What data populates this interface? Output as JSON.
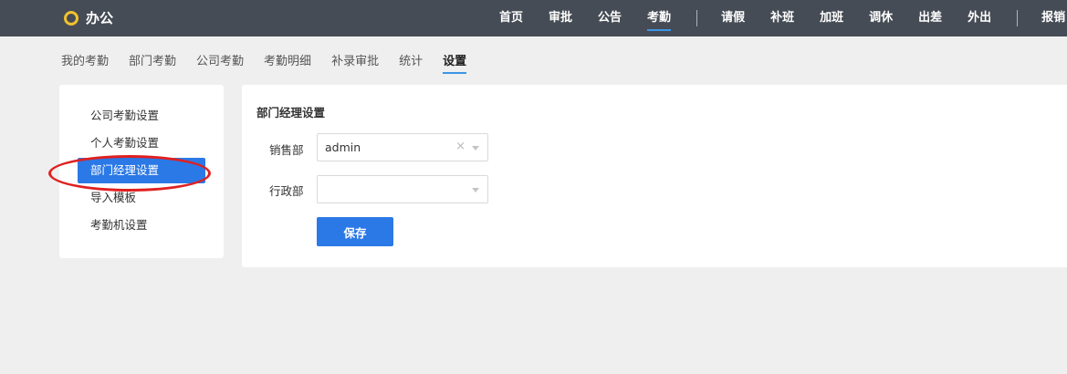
{
  "app": {
    "title": "办公"
  },
  "topnav": {
    "primary": [
      {
        "label": "首页"
      },
      {
        "label": "审批"
      },
      {
        "label": "公告"
      },
      {
        "label": "考勤",
        "active": true
      }
    ],
    "secondary": [
      {
        "label": "请假"
      },
      {
        "label": "补班"
      },
      {
        "label": "加班"
      },
      {
        "label": "调休"
      },
      {
        "label": "出差"
      },
      {
        "label": "外出"
      }
    ],
    "tertiary": [
      {
        "label": "报销"
      }
    ]
  },
  "subnav": {
    "tabs": [
      {
        "label": "我的考勤"
      },
      {
        "label": "部门考勤"
      },
      {
        "label": "公司考勤"
      },
      {
        "label": "考勤明细"
      },
      {
        "label": "补录审批"
      },
      {
        "label": "统计"
      },
      {
        "label": "设置",
        "active": true
      }
    ]
  },
  "sidemenu": {
    "items": [
      {
        "label": "公司考勤设置"
      },
      {
        "label": "个人考勤设置"
      },
      {
        "label": "部门经理设置",
        "active": true
      },
      {
        "label": "导入模板"
      },
      {
        "label": "考勤机设置"
      }
    ]
  },
  "panel": {
    "title": "部门经理设置",
    "rows": [
      {
        "label": "销售部",
        "value": "admin",
        "clear": "×"
      },
      {
        "label": "行政部",
        "value": ""
      }
    ],
    "save_label": "保存"
  },
  "colors": {
    "topbar_bg": "#464c55",
    "accent": "#2b79e6",
    "logo_ring": "#f2c12e",
    "highlight_circle": "#e02020"
  }
}
